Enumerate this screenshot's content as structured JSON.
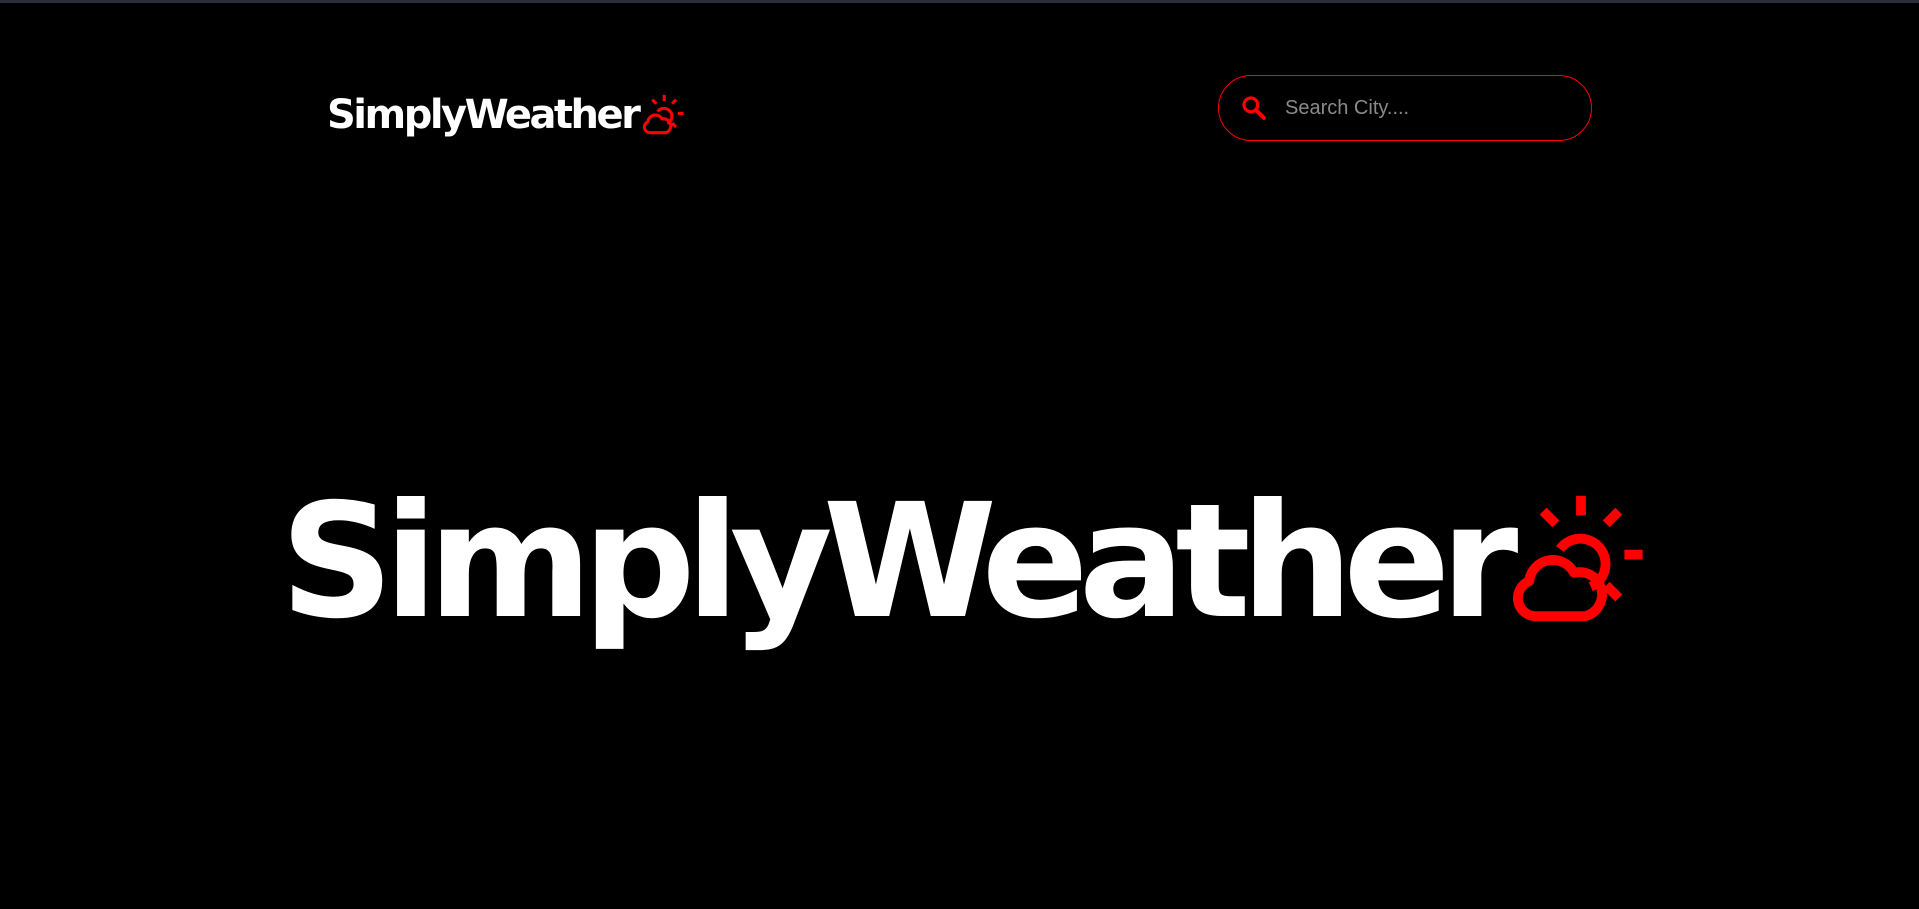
{
  "header": {
    "logo_text": "SimplyWeather",
    "search": {
      "placeholder": "Search City....",
      "value": "",
      "icon": "search-icon"
    }
  },
  "hero": {
    "logo_text": "SimplyWeather",
    "logo_icon": "sun-cloud-icon"
  },
  "colors": {
    "background": "#000000",
    "text": "#ffffff",
    "accent": "#ff0000"
  }
}
